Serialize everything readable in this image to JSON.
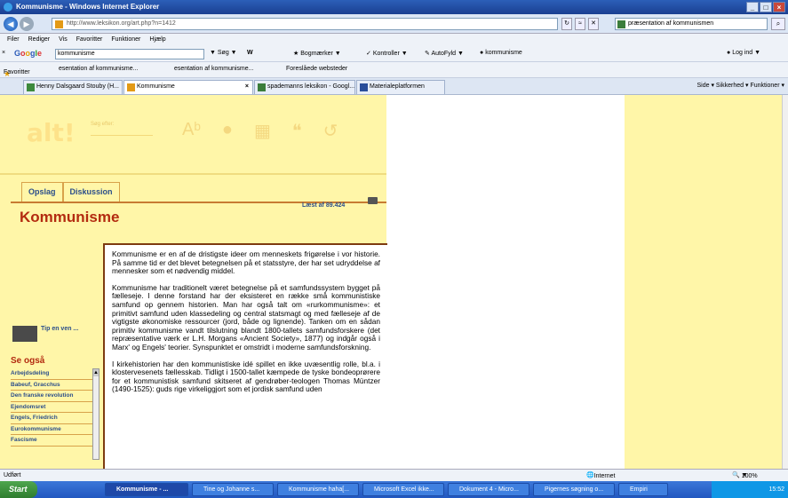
{
  "window": {
    "title": "Kommunisme - Windows Internet Explorer",
    "buttons": [
      "_",
      "□",
      "×"
    ]
  },
  "address": {
    "url": "http://www.leksikon.org/art.php?n=1412",
    "search_value": "præsentation af kommunismen"
  },
  "menu": [
    "Filer",
    "Rediger",
    "Vis",
    "Favoritter",
    "Funktioner",
    "Hjælp"
  ],
  "google": {
    "query": "kommunisme",
    "seg_label": "Søg",
    "bookmarks_label": "Bogmærker",
    "kontroller_label": "Kontroller",
    "autofyld_label": "AutoFyld",
    "keyword": "kommunisme",
    "login": "Log ind"
  },
  "favorites": {
    "label": "Favoritter",
    "items": [
      "esentation af kommunisme...",
      "esentation af kommunisme...",
      "Foreslåede websteder"
    ]
  },
  "tabs": [
    {
      "label": "Henny Dalsgaard Stouby (H..."
    },
    {
      "label": "Kommunisme"
    },
    {
      "label": "spademanns leksikon - Googl..."
    },
    {
      "label": "Materialeplatformen"
    }
  ],
  "commandbar": "Side ▾  Sikkerhed ▾  Funktioner ▾",
  "page": {
    "logo": "alt!",
    "search_placeholder": "Søg efter:",
    "tab_opslag": "Opslag",
    "tab_diskussion": "Diskussion",
    "read_count": "Læst af 89.424",
    "title": "Kommunisme",
    "paragraphs": [
      "Kommunisme er en af de dristigste ideer om menneskets frigørelse i vor historie. På samme tid er det blevet betegnelsen på et statsstyre, der har set udryddelse af mennesker som et nødvendig middel.",
      "Kommunisme har traditionelt været betegnelse på et samfundssystem bygget på fælleseje. I denne forstand har der eksisteret en række små kommunistiske samfund op gennem historien. Man har også talt om «rurkommunisme»: et primitivt samfund uden klassedeling og central statsmagt og med fælleseje af de vigtigste økonomiske ressourcer (jord, både og lignende). Tanken om en sådan primitiv kommunisme vandt tilslutning blandt 1800-tallets samfundsforskere (det repræsentative værk er L.H. Morgans «Ancient Society», 1877) og indgår også i Marx' og Engels' teorier. Synspunktet er omstridt i moderne samfundsforskning.",
      "I kirkehistorien har den kommunistiske idé spillet en ikke uvæsentlig rolle, bl.a. i klostervesenets fællesskab. Tidligt i 1500-tallet kæmpede de tyske bondeoprørere for et kommunistisk samfund skitseret af gendrøber-teologen Thomas Müntzer (1490-1525): guds rige virkeliggjort som et jordisk samfund uden"
    ],
    "tip": "Tip en ven ...",
    "see_also_heading": "Se også",
    "see_also": [
      "Arbejdsdeling",
      "Babeuf, Gracchus",
      "Den franske revolution",
      "Ejendomsret",
      "Engels, Friedrich",
      "Eurokommunisme",
      "Fascisme"
    ]
  },
  "status": {
    "left": "Udført",
    "zone": "Internet",
    "zoom": "100%"
  },
  "taskbar": {
    "start": "Start",
    "buttons": [
      "Kommunisme - ...",
      "Tine og Johanne s...",
      "Kommunisme haha[...",
      "Microsoft Excel ikke...",
      "Dokument 4 - Micro...",
      "Pigernes søgning o...",
      "Empiri"
    ],
    "clock": "15:52"
  }
}
